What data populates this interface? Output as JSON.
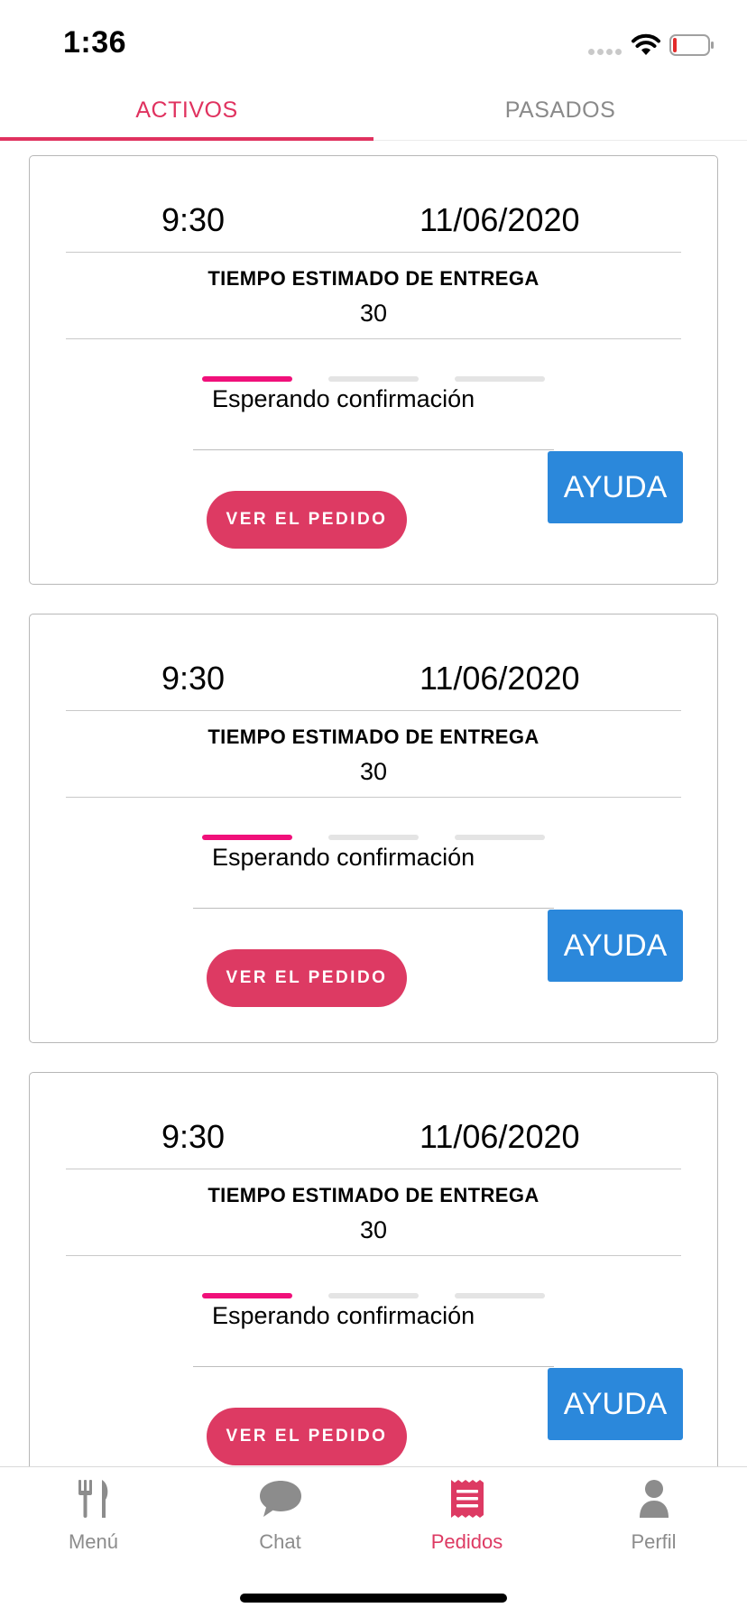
{
  "status_bar": {
    "time": "1:36"
  },
  "tabs": [
    {
      "label": "ACTIVOS",
      "active": true
    },
    {
      "label": "PASADOS",
      "active": false
    }
  ],
  "orders": [
    {
      "time": "9:30",
      "date": "11/06/2020",
      "eta_label": "TIEMPO ESTIMADO DE ENTREGA",
      "eta_value": "30",
      "progress_step": 1,
      "progress_total": 3,
      "status": "Esperando confirmación",
      "help_label": "AYUDA",
      "view_label": "VER EL PEDIDO"
    },
    {
      "time": "9:30",
      "date": "11/06/2020",
      "eta_label": "TIEMPO ESTIMADO DE ENTREGA",
      "eta_value": "30",
      "progress_step": 1,
      "progress_total": 3,
      "status": "Esperando confirmación",
      "help_label": "AYUDA",
      "view_label": "VER EL PEDIDO"
    },
    {
      "time": "9:30",
      "date": "11/06/2020",
      "eta_label": "TIEMPO ESTIMADO DE ENTREGA",
      "eta_value": "30",
      "progress_step": 1,
      "progress_total": 3,
      "status": "Esperando confirmación",
      "help_label": "AYUDA",
      "view_label": "VER EL PEDIDO"
    }
  ],
  "bottom_nav": [
    {
      "label": "Menú",
      "icon": "fork-knife-icon",
      "active": false
    },
    {
      "label": "Chat",
      "icon": "chat-bubble-icon",
      "active": false
    },
    {
      "label": "Pedidos",
      "icon": "receipt-icon",
      "active": true
    },
    {
      "label": "Perfil",
      "icon": "person-icon",
      "active": false
    }
  ],
  "colors": {
    "accent": "#dd3a63",
    "progress_active": "#f0107a",
    "progress_inactive": "#e4e4e4",
    "help_button": "#2b88db",
    "inactive_gray": "#8c8c8c"
  }
}
